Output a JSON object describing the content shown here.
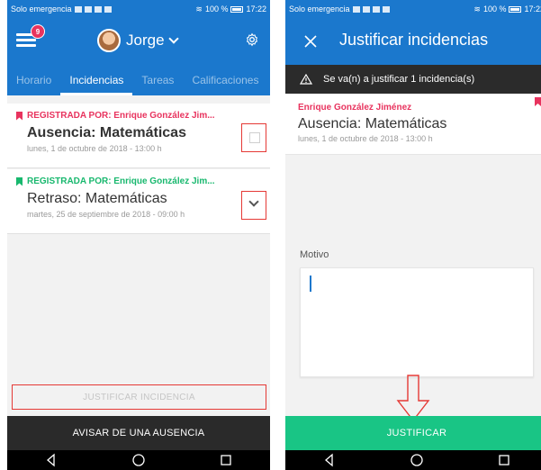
{
  "colors": {
    "primary_blue": "#1b78cd",
    "accent_pink": "#e8335e",
    "accent_green": "#18b86e",
    "justify_green": "#19c585",
    "highlight_red": "#e53935"
  },
  "left": {
    "statusbar": {
      "carrier": "Solo emergencia",
      "battery": "100 %",
      "time": "17:22"
    },
    "header": {
      "badge_count": "9",
      "user_name": "Jorge",
      "menu_icon": "menu-icon",
      "settings_icon": "gear-icon"
    },
    "tabs": [
      {
        "label": "Horario",
        "active": false
      },
      {
        "label": "Incidencias",
        "active": true
      },
      {
        "label": "Tareas",
        "active": false
      },
      {
        "label": "Calificaciones",
        "active": false
      }
    ],
    "incidents": [
      {
        "registered_by": "REGISTRADA POR: Enrique González Jim...",
        "title": "Ausencia: Matemáticas",
        "date": "lunes, 1 de octubre de 2018 - 13:00 h",
        "flag_color": "#e8335e",
        "control": "checkbox"
      },
      {
        "registered_by": "REGISTRADA POR: Enrique González Jim...",
        "title": "Retraso: Matemáticas",
        "date": "martes, 25 de septiembre de 2018 - 09:00 h",
        "flag_color": "#18b86e",
        "control": "chevron-down"
      }
    ],
    "justify_button": "JUSTIFICAR INCIDENCIA",
    "notify_button": "AVISAR DE UNA AUSENCIA"
  },
  "right": {
    "statusbar": {
      "carrier": "Solo emergencia",
      "battery": "100 %",
      "time": "17:22"
    },
    "header": {
      "title": "Justificar incidencias",
      "close_icon": "close-icon"
    },
    "notice": "Se va(n) a justificar 1 incidencia(s)",
    "incident": {
      "author": "Enrique González Jiménez",
      "title": "Ausencia: Matemáticas",
      "date": "lunes, 1 de octubre de 2018 - 13:00 h"
    },
    "reason_label": "Motivo",
    "reason_value": "",
    "justify_button": "JUSTIFICAR"
  }
}
